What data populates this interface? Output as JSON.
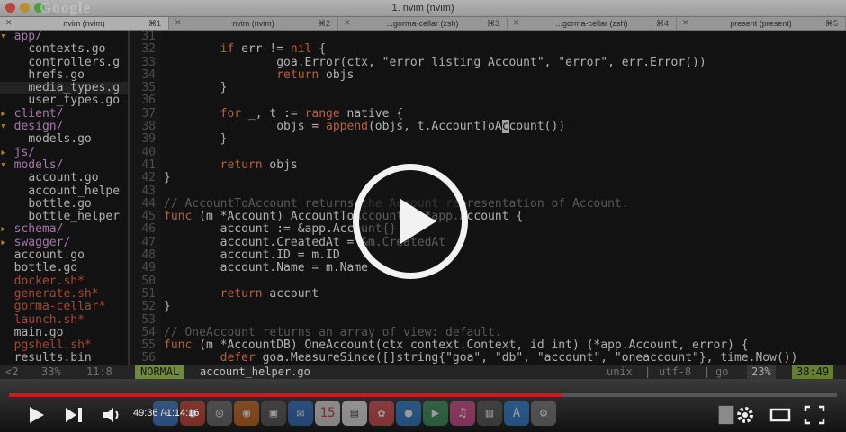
{
  "window": {
    "title": "1. nvim (nvim)",
    "brand": "Google"
  },
  "tabs": [
    {
      "label": "nvim (nvim)",
      "key": "⌘1"
    },
    {
      "label": "nvim (nvim)",
      "key": "⌘2"
    },
    {
      "label": "...gorma-cellar (zsh)",
      "key": "⌘3"
    },
    {
      "label": "...gorma-cellar (zsh)",
      "key": "⌘4"
    },
    {
      "label": "present (present)",
      "key": "⌘5"
    }
  ],
  "tree": [
    {
      "arrow": "▾ ",
      "name": "app/",
      "kind": "dir"
    },
    {
      "arrow": "    ",
      "name": "contexts.go",
      "kind": "file"
    },
    {
      "arrow": "    ",
      "name": "controllers.g",
      "kind": "file"
    },
    {
      "arrow": "    ",
      "name": "hrefs.go",
      "kind": "file"
    },
    {
      "arrow": "    ",
      "name": "media_types.g",
      "kind": "file"
    },
    {
      "arrow": "    ",
      "name": "user_types.go",
      "kind": "file"
    },
    {
      "arrow": "▸ ",
      "name": "client/",
      "kind": "dir"
    },
    {
      "arrow": "▾ ",
      "name": "design/",
      "kind": "dir"
    },
    {
      "arrow": "    ",
      "name": "models.go",
      "kind": "file"
    },
    {
      "arrow": "▸ ",
      "name": "js/",
      "kind": "dir"
    },
    {
      "arrow": "▾ ",
      "name": "models/",
      "kind": "dir"
    },
    {
      "arrow": "    ",
      "name": "account.go",
      "kind": "file"
    },
    {
      "arrow": "    ",
      "name": "account_helpe",
      "kind": "file"
    },
    {
      "arrow": "    ",
      "name": "bottle.go",
      "kind": "file"
    },
    {
      "arrow": "    ",
      "name": "bottle_helper",
      "kind": "file"
    },
    {
      "arrow": "▸ ",
      "name": "schema/",
      "kind": "dir"
    },
    {
      "arrow": "▸ ",
      "name": "swagger/",
      "kind": "dir"
    },
    {
      "arrow": "  ",
      "name": "account.go",
      "kind": "file"
    },
    {
      "arrow": "  ",
      "name": "bottle.go",
      "kind": "file"
    },
    {
      "arrow": "  ",
      "name": "docker.sh*",
      "kind": "exec"
    },
    {
      "arrow": "  ",
      "name": "generate.sh*",
      "kind": "exec"
    },
    {
      "arrow": "  ",
      "name": "gorma-cellar*",
      "kind": "exec"
    },
    {
      "arrow": "  ",
      "name": "launch.sh*",
      "kind": "exec"
    },
    {
      "arrow": "  ",
      "name": "main.go",
      "kind": "file"
    },
    {
      "arrow": "  ",
      "name": "pgshell.sh*",
      "kind": "exec"
    },
    {
      "arrow": "  ",
      "name": "results.bin",
      "kind": "file"
    }
  ],
  "lines": [
    "31",
    "32",
    "33",
    "34",
    "35",
    "36",
    "37",
    "38",
    "39",
    "40",
    "41",
    "42",
    "43",
    "44",
    "45",
    "46",
    "47",
    "48",
    "49",
    "50",
    "51",
    "52",
    "53",
    "54",
    "55",
    "56"
  ],
  "code": [
    [],
    [
      [
        "        ",
        ""
      ],
      [
        "if",
        "kw"
      ],
      [
        " err != ",
        ""
      ],
      [
        "nil",
        "kw"
      ],
      [
        " {",
        ""
      ]
    ],
    [
      [
        "                goa.Error(ctx, \"error listing Account\", \"error\", err.Error())",
        ""
      ]
    ],
    [
      [
        "                ",
        ""
      ],
      [
        "return",
        "kw"
      ],
      [
        " objs",
        ""
      ]
    ],
    [
      [
        "        }",
        ""
      ]
    ],
    [],
    [
      [
        "        ",
        ""
      ],
      [
        "for",
        "kw"
      ],
      [
        " _, t := ",
        ""
      ],
      [
        "range",
        "kw"
      ],
      [
        " native {",
        ""
      ]
    ],
    [
      [
        "                objs = ",
        ""
      ],
      [
        "append",
        "kw"
      ],
      [
        "(objs, t.AccountToA",
        ""
      ],
      [
        "c",
        "cursor"
      ],
      [
        "count())",
        ""
      ]
    ],
    [
      [
        "        }",
        ""
      ]
    ],
    [],
    [
      [
        "        ",
        ""
      ],
      [
        "return",
        "kw"
      ],
      [
        " objs",
        ""
      ]
    ],
    [
      [
        "}",
        ""
      ]
    ],
    [],
    [
      [
        "// AccountToAccount returns the Account representation of Account.",
        "cm"
      ]
    ],
    [
      [
        "func",
        "kw"
      ],
      [
        " (m *Account) AccountToAccount() *app.Account {",
        ""
      ]
    ],
    [
      [
        "        account := &app.Account{}",
        ""
      ]
    ],
    [
      [
        "        account.CreatedAt = &m.CreatedAt",
        ""
      ]
    ],
    [
      [
        "        account.ID = m.ID",
        ""
      ]
    ],
    [
      [
        "        account.Name = m.Name",
        ""
      ]
    ],
    [],
    [
      [
        "        ",
        ""
      ],
      [
        "return",
        "kw"
      ],
      [
        " account",
        ""
      ]
    ],
    [
      [
        "}",
        ""
      ]
    ],
    [],
    [
      [
        "// OneAccount returns an array of view: default.",
        "cm"
      ]
    ],
    [
      [
        "func",
        "kw"
      ],
      [
        " (m *AccountDB) OneAccount(ctx context.Context, id int) (*app.Account, error) {",
        ""
      ]
    ],
    [
      [
        "        ",
        ""
      ],
      [
        "defer",
        "kw"
      ],
      [
        " goa.MeasureSince([]string{\"goa\", \"db\", \"account\", \"oneaccount\"}, time.Now())",
        ""
      ]
    ]
  ],
  "status": {
    "left_buf": "<2",
    "left_pct": "33%",
    "left_pos": "11:8",
    "mode": "NORMAL",
    "file": "account_helper.go",
    "format": "unix",
    "encoding": "utf-8",
    "filetype": "go",
    "percent": "23%",
    "position": "38:49"
  },
  "player": {
    "time": "49:36 / 1:14:16",
    "progress_fraction": 0.668
  }
}
